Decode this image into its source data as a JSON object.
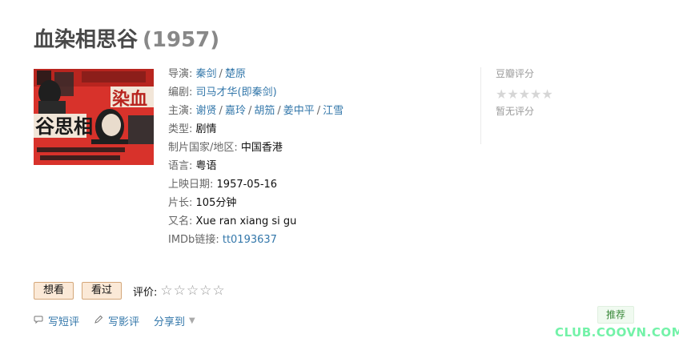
{
  "title": {
    "name": "血染相思谷",
    "year": "(1957)"
  },
  "poster": {
    "alt": "血染相思谷 poster",
    "colors": {
      "bg": "#d8322b",
      "dark": "#1a1a1a",
      "light": "#f2e6d8"
    }
  },
  "info": {
    "director_label": "导演:",
    "directors": [
      "秦剑",
      "楚原"
    ],
    "writer_label": "编剧:",
    "writers": [
      "司马才华(即秦剑)"
    ],
    "cast_label": "主演:",
    "cast": [
      "谢贤",
      "嘉玲",
      "胡笳",
      "姜中平",
      "江雪"
    ],
    "genre_label": "类型:",
    "genre": "剧情",
    "country_label": "制片国家/地区:",
    "country": "中国香港",
    "language_label": "语言:",
    "language": "粤语",
    "release_label": "上映日期:",
    "release": "1957-05-16",
    "runtime_label": "片长:",
    "runtime": "105分钟",
    "aka_label": "又名:",
    "aka": "Xue ran xiang si gu",
    "imdb_label": "IMDb链接:",
    "imdb": "tt0193637",
    "separator": "/"
  },
  "rating": {
    "title": "豆瓣评分",
    "stars": "★★★★★",
    "none_text": "暂无评分"
  },
  "actions": {
    "want_label": "想看",
    "seen_label": "看过",
    "rate_label": "评价:",
    "rate_stars": "☆☆☆☆☆"
  },
  "links": {
    "short_review": "写短评",
    "review": "写影评",
    "share": "分享到",
    "caret": "▼"
  },
  "recommend_label": "推荐",
  "watermark": "CLUB.COOVN.COM"
}
